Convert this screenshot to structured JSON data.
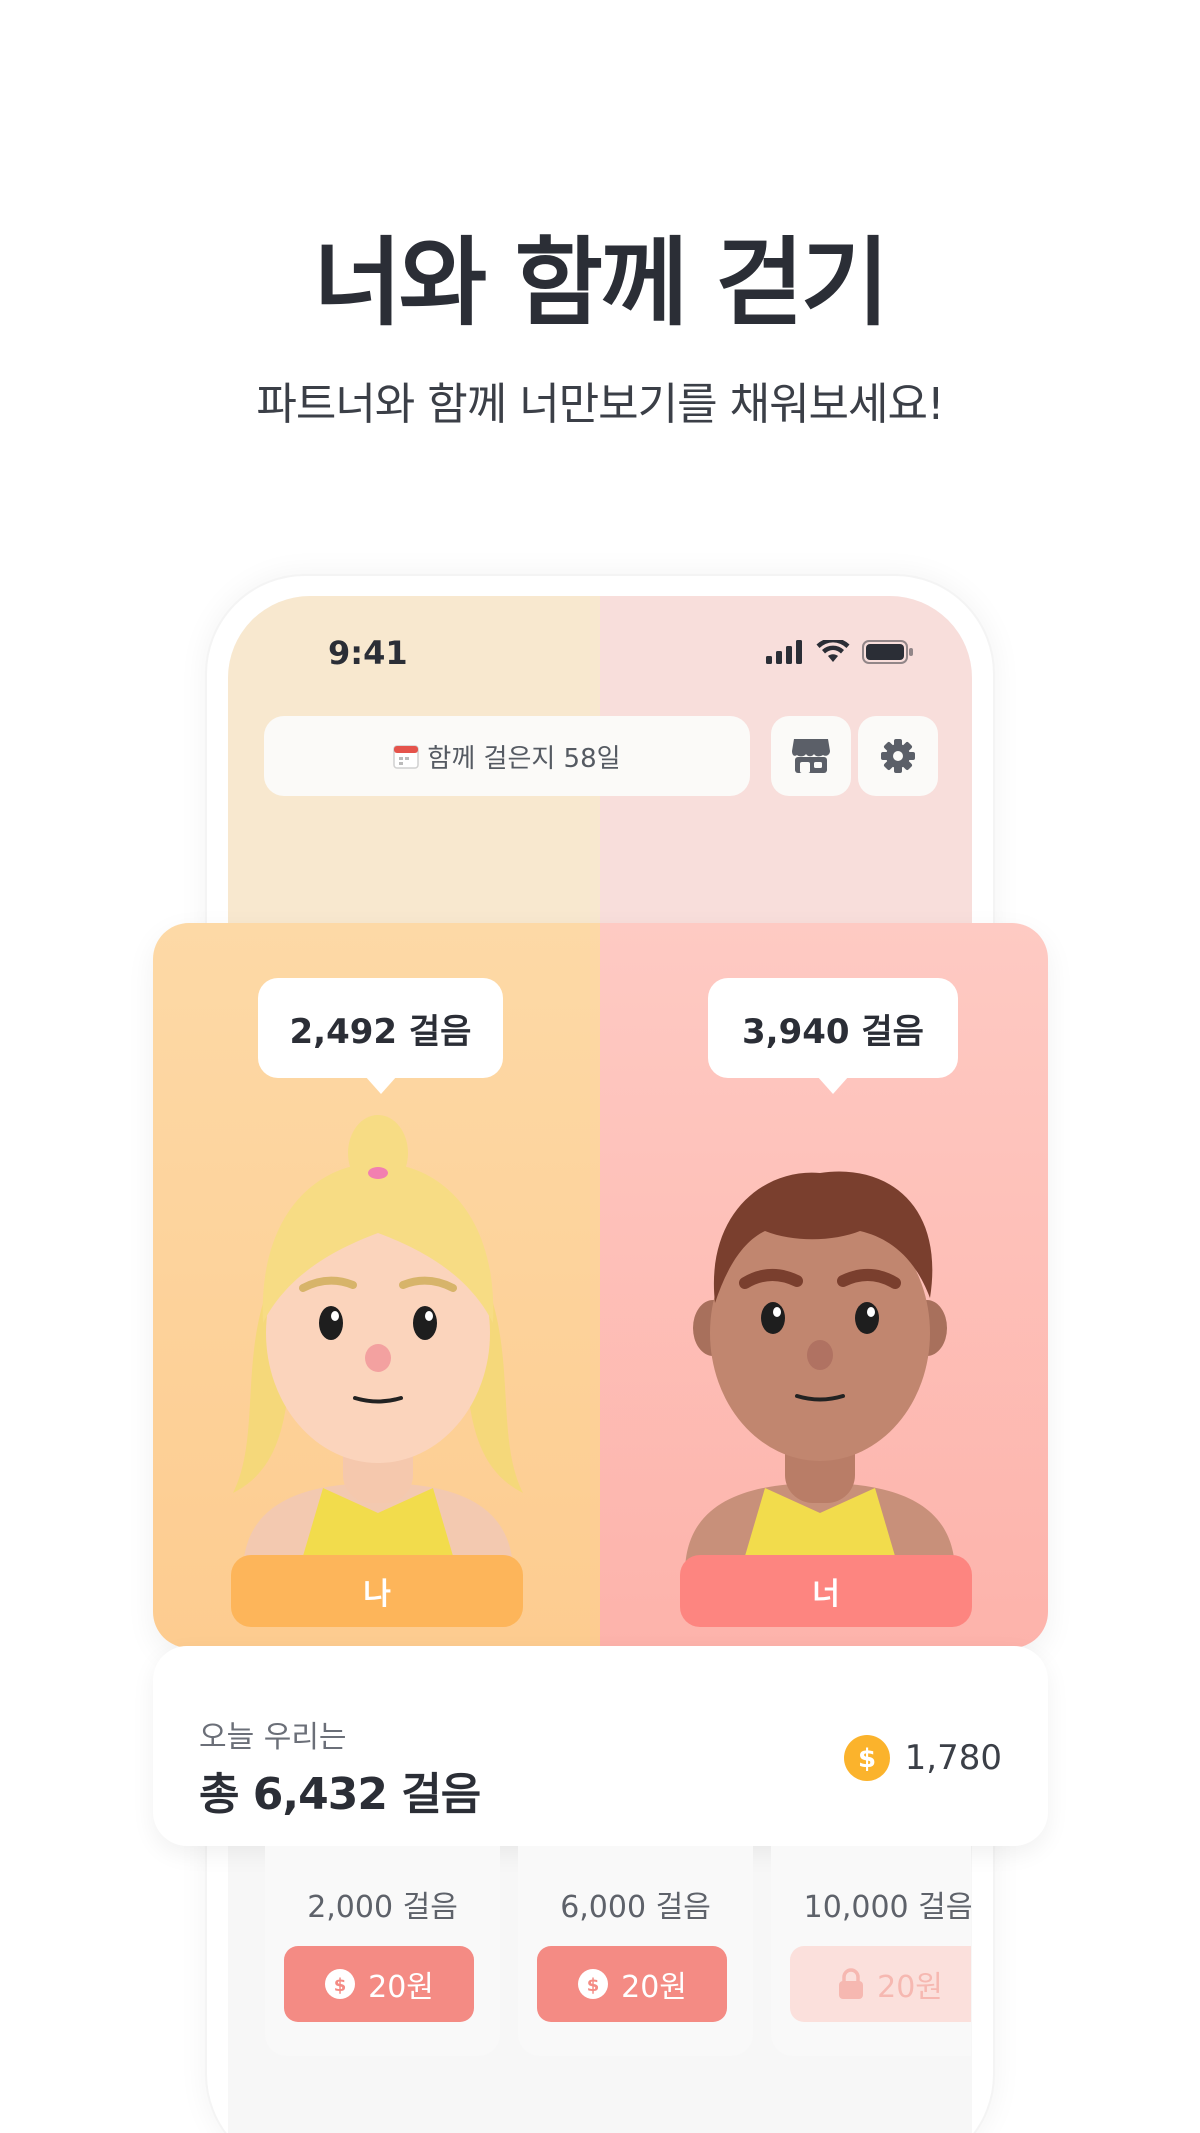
{
  "hero": {
    "title": "너와 함께 걷기",
    "subtitle": "파트너와 함께 너만보기를 채워보세요!"
  },
  "status_bar": {
    "time": "9:41"
  },
  "header": {
    "days_icon": "calendar-icon",
    "days_label": "함께 걸은지 58일",
    "store_icon": "store-icon",
    "settings_icon": "gear-icon"
  },
  "partners": {
    "me": {
      "steps": "2,492 걸음",
      "tag": "나",
      "color": "#fdb55a"
    },
    "you": {
      "steps": "3,940 걸음",
      "tag": "너",
      "color": "#fd8580"
    }
  },
  "today": {
    "label": "오늘 우리는",
    "total": "총 6,432 걸음",
    "coins": "1,780",
    "coin_color": "#fbb32c"
  },
  "rewards": [
    {
      "goal": "2,000 걸음",
      "amount": "20원",
      "state": "available"
    },
    {
      "goal": "6,000 걸음",
      "amount": "20원",
      "state": "available"
    },
    {
      "goal": "10,000 걸음",
      "amount": "20원",
      "state": "locked"
    }
  ]
}
